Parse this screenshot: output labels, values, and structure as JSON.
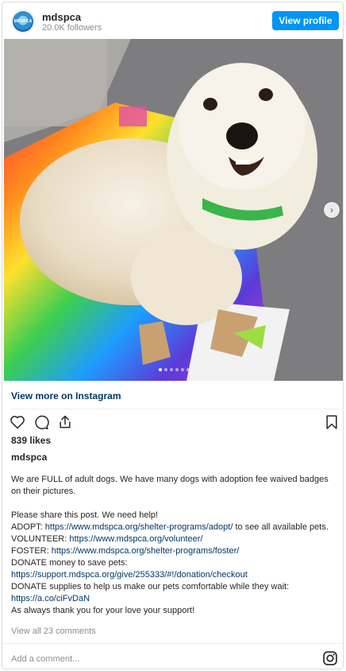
{
  "header": {
    "username": "mdspca",
    "followers": "20.0K followers",
    "view_profile": "View profile",
    "avatar_text": "MDSPCA"
  },
  "post": {
    "image_icon": "next-arrow-icon",
    "dots_count": 6,
    "active_dot": 0,
    "view_more": "View more on Instagram",
    "likes": "839 likes",
    "owner": "mdspca",
    "caption": {
      "l1": "We are FULL of adult dogs. We have many dogs with adoption fee waived badges on their pictures.",
      "l2": "Please share this post. We need help!",
      "adopt_prefix": "ADOPT: ",
      "adopt_link": "https://www.mdspca.org/shelter-programs/adopt/",
      "adopt_suffix": " to see all available pets.",
      "volunteer_prefix": "VOLUNTEER: ",
      "volunteer_link": "https://www.mdspca.org/volunteer/",
      "foster_prefix": "FOSTER: ",
      "foster_link": "https://www.mdspca.org/shelter-programs/foster/",
      "donate_money": "DONATE money to save pets:",
      "donate_money_link": "https://support.mdspca.org/give/255333/#!/donation/checkout",
      "donate_supplies": "DONATE supplies to help us make our pets comfortable while they wait:",
      "donate_supplies_link": "https://a.co/ciFvDaN",
      "thanks": "As always thank you for your love your support!"
    },
    "comments": "View all 23 comments",
    "add_comment": "Add a comment..."
  },
  "colors": {
    "accent": "#0095f6",
    "link": "#00376b",
    "muted": "#8e8e8e"
  }
}
